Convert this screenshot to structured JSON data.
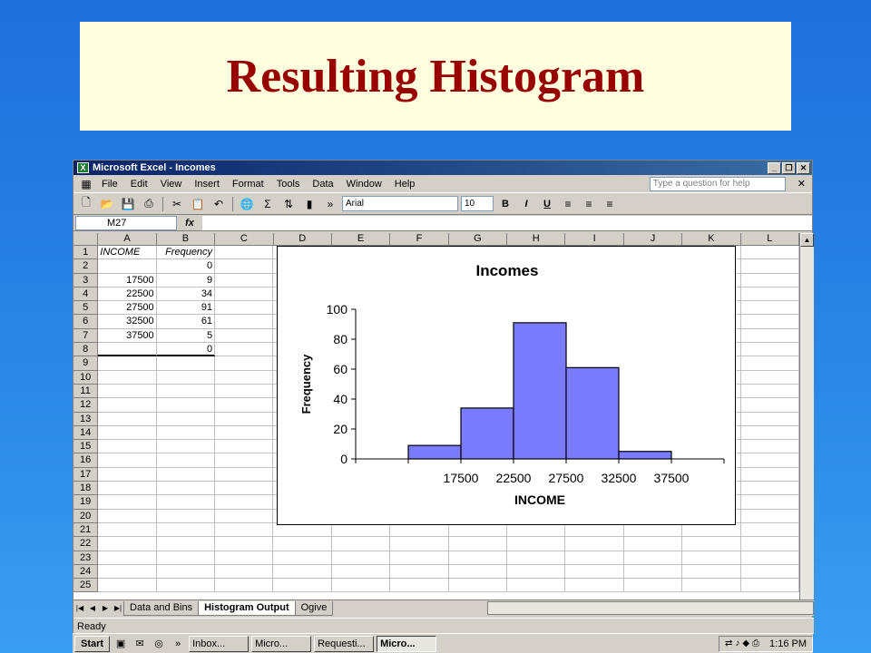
{
  "slide": {
    "title": "Resulting Histogram"
  },
  "window": {
    "title": "Microsoft Excel - Incomes"
  },
  "menu": [
    "File",
    "Edit",
    "View",
    "Insert",
    "Format",
    "Tools",
    "Data",
    "Window",
    "Help"
  ],
  "help_placeholder": "Type a question for help",
  "toolbar": {
    "font": "Arial",
    "size": "10",
    "bold": "B",
    "italic": "I",
    "underline": "U"
  },
  "formula": {
    "cell_ref": "M27",
    "fx": "fx"
  },
  "columns": [
    "A",
    "B",
    "C",
    "D",
    "E",
    "F",
    "G",
    "H",
    "I",
    "J",
    "K",
    "L"
  ],
  "rows": [
    "1",
    "2",
    "3",
    "4",
    "5",
    "6",
    "7",
    "8",
    "9",
    "10",
    "11",
    "12",
    "13",
    "14",
    "15",
    "16",
    "17",
    "18",
    "19",
    "20",
    "21",
    "22",
    "23",
    "24",
    "25"
  ],
  "table": {
    "header": [
      "INCOME",
      "Frequency"
    ],
    "data": [
      [
        "",
        "0"
      ],
      [
        "17500",
        "9"
      ],
      [
        "22500",
        "34"
      ],
      [
        "27500",
        "91"
      ],
      [
        "32500",
        "61"
      ],
      [
        "37500",
        "5"
      ],
      [
        "",
        "0"
      ]
    ]
  },
  "sheet_tabs": [
    "Data and Bins",
    "Histogram Output",
    "Ogive"
  ],
  "active_tab": "Histogram Output",
  "status": "Ready",
  "taskbar": {
    "start": "Start",
    "buttons": [
      "Inbox...",
      "Micro...",
      "Requesti...",
      "Micro..."
    ],
    "clock": "1:16 PM"
  },
  "chart_data": {
    "type": "bar",
    "title": "Incomes",
    "xlabel": "INCOME",
    "ylabel": "Frequency",
    "categories": [
      "17500",
      "22500",
      "27500",
      "32500",
      "37500"
    ],
    "values": [
      9,
      34,
      91,
      61,
      5
    ],
    "ylim": [
      0,
      100
    ],
    "yticks": [
      0,
      20,
      40,
      60,
      80,
      100
    ],
    "bar_color": "#7b7bff",
    "grid": false
  }
}
